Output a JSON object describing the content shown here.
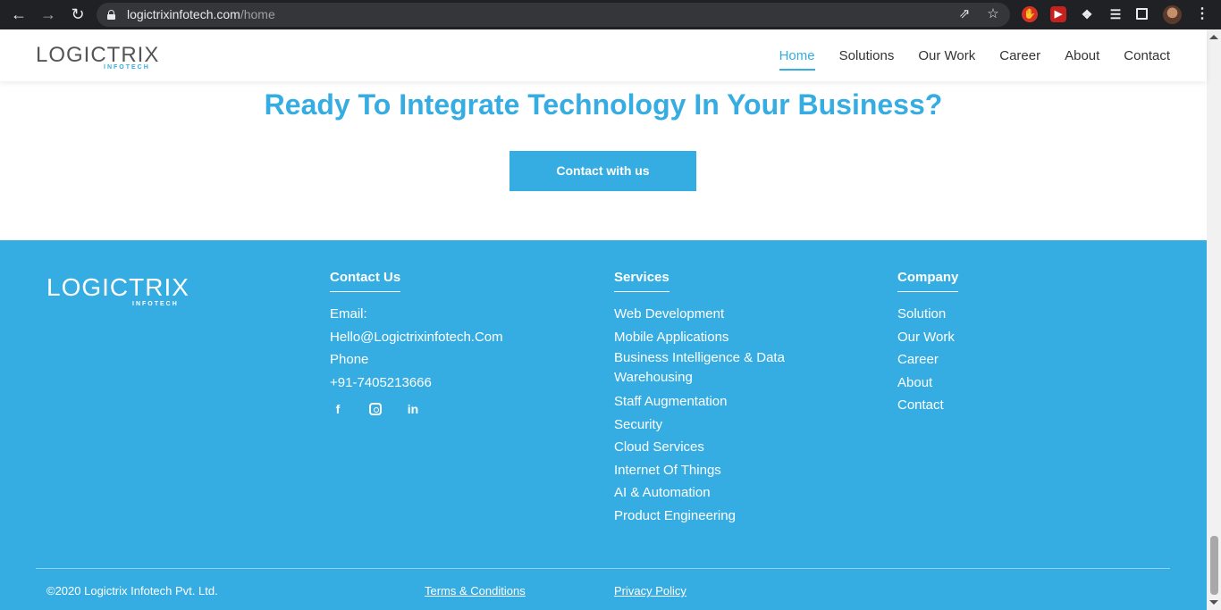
{
  "browser": {
    "url_host": "logictrixinfotech.com",
    "url_path": "/home",
    "back_icon": "arrow-left",
    "forward_icon": "arrow-right",
    "reload_icon": "reload",
    "share_icon": "share",
    "star_icon": "star"
  },
  "header": {
    "logo_word": "LOGICTRIX",
    "logo_sub": "INFOTECH",
    "nav": [
      {
        "label": "Home"
      },
      {
        "label": "Solutions"
      },
      {
        "label": "Our Work"
      },
      {
        "label": "Career"
      },
      {
        "label": "About"
      },
      {
        "label": "Contact"
      }
    ]
  },
  "cta": {
    "title": "Ready To Integrate Technology In Your Business?",
    "button": "Contact with us"
  },
  "footer": {
    "logo_word": "LOGICTRIX",
    "logo_sub": "INFOTECH",
    "contact": {
      "heading": "Contact Us",
      "email_label": "Email:",
      "email": "Hello@Logictrixinfotech.Com",
      "phone_label": "Phone",
      "phone": "+91-7405213666",
      "social": [
        "f",
        "in"
      ]
    },
    "services": {
      "heading": "Services",
      "items": [
        "Web Development",
        "Mobile Applications",
        "Business Intelligence & Data Warehousing",
        "Staff Augmentation",
        "Security",
        "Cloud Services",
        "Internet Of Things",
        "AI & Automation",
        "Product Engineering"
      ]
    },
    "company": {
      "heading": "Company",
      "items": [
        "Solution",
        "Our Work",
        "Career",
        "About",
        "Contact"
      ]
    },
    "copyright": "©2020 Logictrix Infotech Pvt. Ltd.",
    "terms": "Terms & Conditions",
    "privacy": "Privacy Policy"
  },
  "colors": {
    "brand": "#36ade2",
    "chrome": "#202124"
  }
}
